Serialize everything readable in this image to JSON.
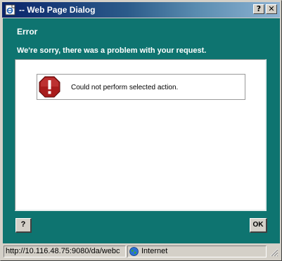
{
  "window": {
    "title": "-- Web Page Dialog",
    "help_button": "?",
    "close_button": "✕"
  },
  "dialog": {
    "heading": "Error",
    "subheading": "We're sorry, there was a problem with your request.",
    "message": "Could not perform selected action.",
    "help_button": "?",
    "ok_button": "OK"
  },
  "status": {
    "url": "http://10.116.48.75:9080/da/webc",
    "zone": "Internet"
  },
  "colors": {
    "content_bg": "#0e7470",
    "title_gradient_start": "#0a246a",
    "error_icon": "#a81c1c"
  },
  "icons": {
    "title": "ie-page-icon",
    "error": "error-warning-icon",
    "zone": "globe-icon",
    "resize": "resize-grip-icon"
  }
}
